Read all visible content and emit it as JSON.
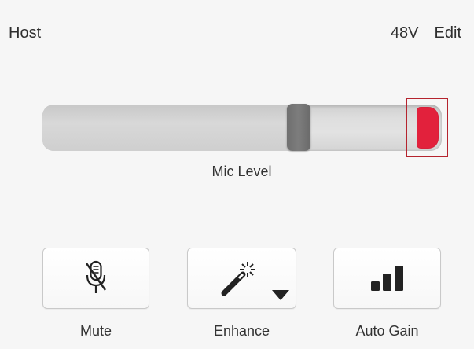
{
  "header": {
    "title": "Host",
    "phantom_power_label": "48V",
    "edit_label": "Edit"
  },
  "fader": {
    "label": "Mic Level",
    "level_fraction": 0.63,
    "clip_indicator_active": true,
    "clip_color": "#e2213c"
  },
  "buttons": {
    "mute": {
      "label": "Mute",
      "icon": "mic-muted-icon"
    },
    "enhance": {
      "label": "Enhance",
      "icon": "magic-wand-icon",
      "dropdown_icon": "triangle-down-icon"
    },
    "auto_gain": {
      "label": "Auto Gain",
      "icon": "signal-bars-icon"
    }
  }
}
